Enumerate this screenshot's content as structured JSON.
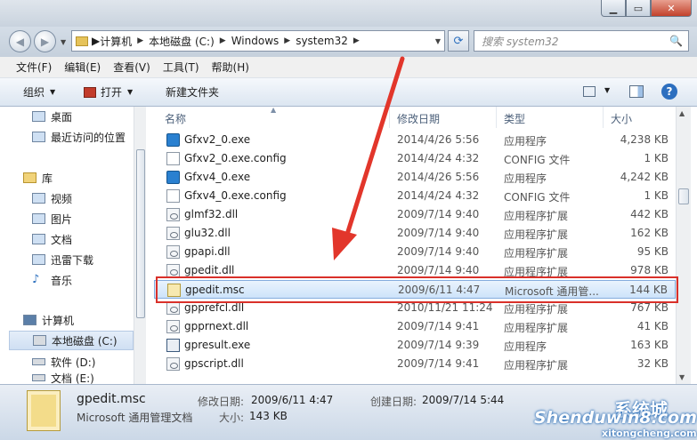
{
  "address": {
    "crumbs": [
      "计算机",
      "本地磁盘 (C:)",
      "Windows",
      "system32"
    ],
    "search_placeholder": "搜索 system32"
  },
  "menu": [
    "文件(F)",
    "编辑(E)",
    "查看(V)",
    "工具(T)",
    "帮助(H)"
  ],
  "toolbar": {
    "organize": "组织",
    "open": "打开",
    "new_folder": "新建文件夹"
  },
  "nav": {
    "items": [
      "桌面",
      "最近访问的位置",
      "库",
      "视频",
      "图片",
      "文档",
      "迅雷下载",
      "音乐",
      "计算机",
      "本地磁盘 (C:)",
      "软件 (D:)",
      "文档 (E:)"
    ],
    "selected": "本地磁盘 (C:)"
  },
  "columns": {
    "name": "名称",
    "date": "修改日期",
    "type": "类型",
    "size": "大小"
  },
  "files": [
    {
      "name": "Gfxv2_0.exe",
      "date": "2014/4/26 5:56",
      "type": "应用程序",
      "size": "4,238 KB",
      "icon": "exe-icon"
    },
    {
      "name": "Gfxv2_0.exe.config",
      "date": "2014/4/24 4:32",
      "type": "CONFIG 文件",
      "size": "1 KB",
      "icon": "config-icon"
    },
    {
      "name": "Gfxv4_0.exe",
      "date": "2014/4/26 5:56",
      "type": "应用程序",
      "size": "4,242 KB",
      "icon": "exe-icon"
    },
    {
      "name": "Gfxv4_0.exe.config",
      "date": "2014/4/24 4:32",
      "type": "CONFIG 文件",
      "size": "1 KB",
      "icon": "config-icon"
    },
    {
      "name": "glmf32.dll",
      "date": "2009/7/14 9:40",
      "type": "应用程序扩展",
      "size": "442 KB",
      "icon": "dll-icon"
    },
    {
      "name": "glu32.dll",
      "date": "2009/7/14 9:40",
      "type": "应用程序扩展",
      "size": "162 KB",
      "icon": "dll-icon"
    },
    {
      "name": "gpapi.dll",
      "date": "2009/7/14 9:40",
      "type": "应用程序扩展",
      "size": "95 KB",
      "icon": "dll-icon"
    },
    {
      "name": "gpedit.dll",
      "date": "2009/7/14 9:40",
      "type": "应用程序扩展",
      "size": "978 KB",
      "icon": "dll-icon"
    },
    {
      "name": "gpedit.msc",
      "date": "2009/6/11 4:47",
      "type": "Microsoft 通用管...",
      "size": "144 KB",
      "icon": "msc-icon"
    },
    {
      "name": "gpprefcl.dll",
      "date": "2010/11/21 11:24",
      "type": "应用程序扩展",
      "size": "767 KB",
      "icon": "dll-icon"
    },
    {
      "name": "gpprnext.dll",
      "date": "2009/7/14 9:41",
      "type": "应用程序扩展",
      "size": "41 KB",
      "icon": "dll-icon"
    },
    {
      "name": "gpresult.exe",
      "date": "2009/7/14 9:39",
      "type": "应用程序",
      "size": "163 KB",
      "icon": "exe-icon"
    },
    {
      "name": "gpscript.dll",
      "date": "2009/7/14 9:41",
      "type": "应用程序扩展",
      "size": "32 KB",
      "icon": "dll-icon"
    }
  ],
  "selected_file": "gpedit.msc",
  "details": {
    "name": "gpedit.msc",
    "type": "Microsoft 通用管理文档",
    "modified_label": "修改日期:",
    "modified": "2009/6/11 4:47",
    "created_label": "创建日期:",
    "created": "2009/7/14 5:44",
    "size_label": "大小:",
    "size": "143 KB"
  },
  "watermark": {
    "brand": "Shenduwin8.com",
    "cn": "系统城",
    "url": "xitongcheng.com"
  },
  "colors": {
    "highlight_box": "#d9302a",
    "selection": "#cde3fa"
  }
}
